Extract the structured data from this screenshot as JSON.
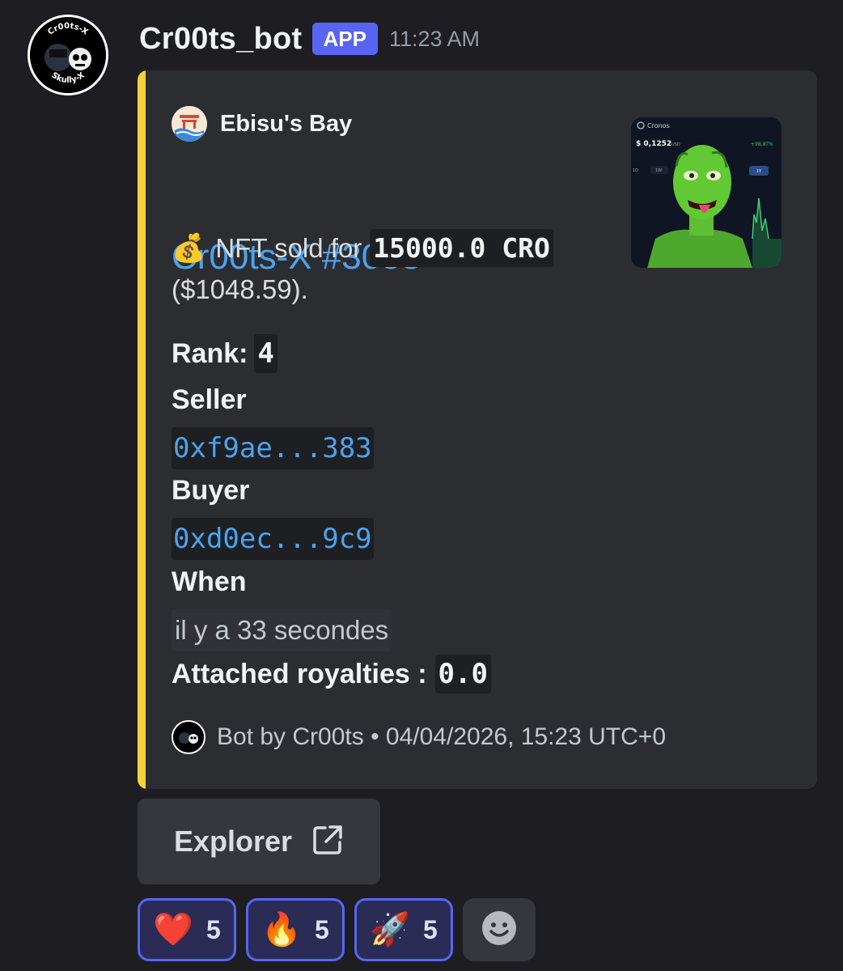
{
  "message": {
    "username": "Cr00ts_bot",
    "badge": "APP",
    "timestamp": "11:23 AM",
    "avatar_text_top": "Cr00ts-X",
    "avatar_text_bottom": "Skully-X"
  },
  "embed": {
    "accent_color": "#f2d33b",
    "author": "Ebisu's Bay",
    "title": "Cr00ts-X #3053",
    "sold_prefix": "NFT sold for",
    "sold_amount": "15000.0 CRO",
    "sold_usd": "($1048.59).",
    "rank_label": "Rank:",
    "rank_value": "4",
    "seller_label": "Seller",
    "seller_address": "0xf9ae...383",
    "buyer_label": "Buyer",
    "buyer_address": "0xd0ec...9c9",
    "when_label": "When",
    "when_value": "il y a 33 secondes",
    "royalties_label": "Attached royalties :",
    "royalties_value": "0.0",
    "footer": "Bot by Cr00ts • 04/04/2026, 15:23 UTC+0",
    "thumbnail": {
      "app_name": "Cronos",
      "price": "$ 0,1252",
      "price_unit": "USD",
      "change": "+98,87%",
      "tabs": [
        "1D",
        "1W",
        "1Y"
      ]
    }
  },
  "explorer_button": {
    "label": "Explorer",
    "icon": "external-link-icon"
  },
  "reactions": [
    {
      "emoji": "❤️",
      "count": "5"
    },
    {
      "emoji": "🔥",
      "count": "5"
    },
    {
      "emoji": "🚀",
      "count": "5"
    }
  ],
  "add_reaction_icon": "smiley-icon"
}
